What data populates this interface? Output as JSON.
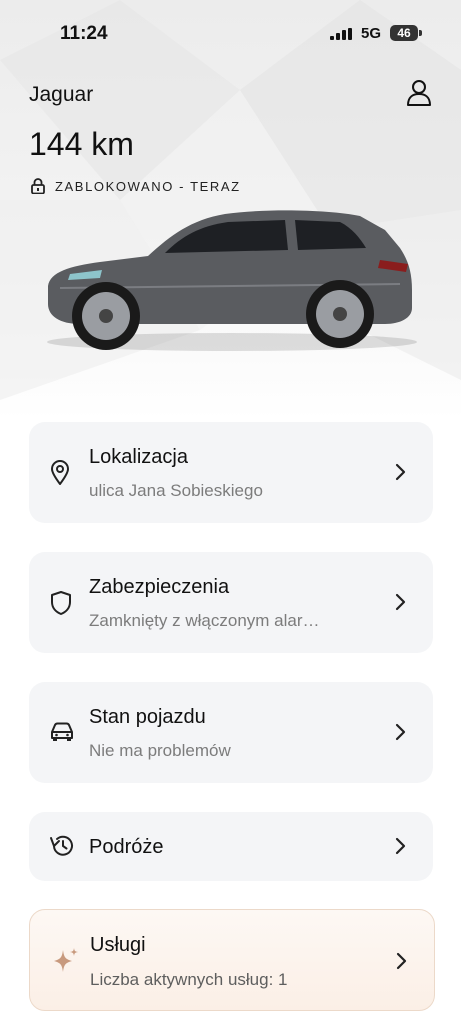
{
  "status_bar": {
    "time": "11:24",
    "network": "5G",
    "battery": "46"
  },
  "header": {
    "brand": "Jaguar",
    "odometer": "144 km",
    "lock_status": "ZABLOKOWANO - TERAZ"
  },
  "cards": [
    {
      "title": "Lokalizacja",
      "subtitle": "ulica Jana Sobieskiego",
      "icon": "location-pin-icon"
    },
    {
      "title": "Zabezpieczenia",
      "subtitle": "Zamknięty z włączonym alar…",
      "icon": "shield-icon"
    },
    {
      "title": "Stan pojazdu",
      "subtitle": "Nie ma problemów",
      "icon": "car-icon"
    },
    {
      "title": "Podróże",
      "subtitle": "",
      "icon": "history-icon"
    },
    {
      "title": "Usługi",
      "subtitle": "Liczba aktywnych usług: 1",
      "icon": "sparkle-icon"
    }
  ],
  "colors": {
    "card_bg": "#f4f5f7",
    "services_bg": "#fbefe6",
    "services_accent": "#c89a7e",
    "text_secondary": "#7c7c7c"
  }
}
